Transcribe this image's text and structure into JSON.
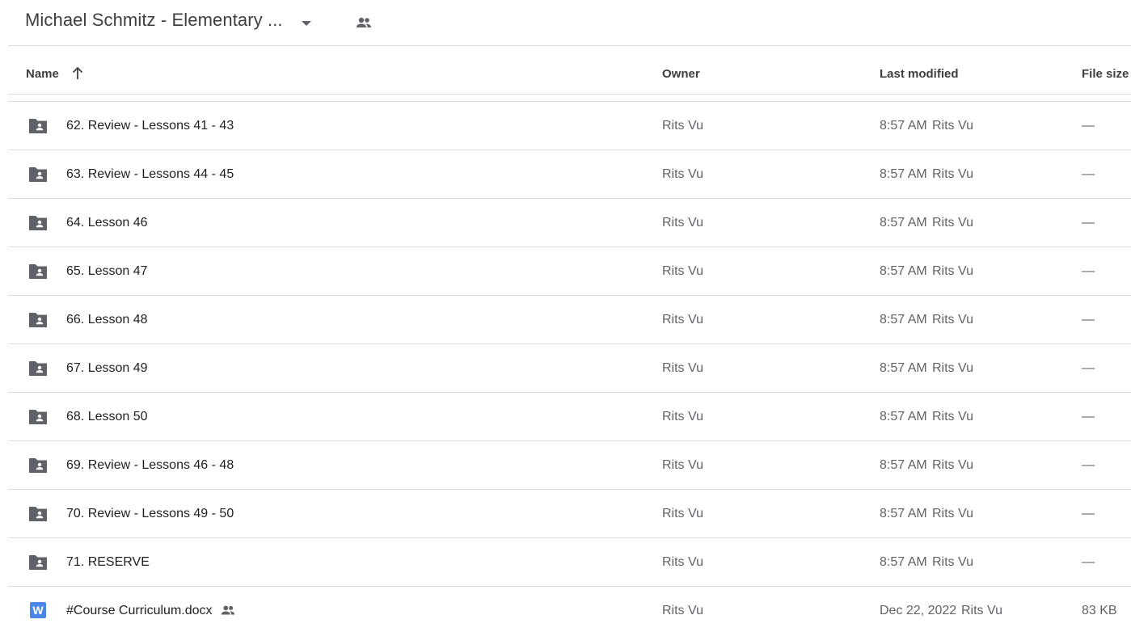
{
  "header": {
    "folder_title": "Michael Schmitz - Elementary ...",
    "dropdown_icon": "arrow-drop-down-icon",
    "shared_icon": "people-icon"
  },
  "columns": {
    "name": "Name",
    "owner": "Owner",
    "last_modified": "Last modified",
    "file_size": "File size",
    "sort_icon": "arrow-up-icon"
  },
  "rows": [
    {
      "name": "62. Review - Lessons 41 - 43",
      "owner": "Rits Vu",
      "modified_date": "8:57 AM",
      "modified_by": "Rits Vu",
      "size": "—",
      "type": "shared-folder"
    },
    {
      "name": "63. Review - Lessons 44 - 45",
      "owner": "Rits Vu",
      "modified_date": "8:57 AM",
      "modified_by": "Rits Vu",
      "size": "—",
      "type": "shared-folder"
    },
    {
      "name": "64. Lesson 46",
      "owner": "Rits Vu",
      "modified_date": "8:57 AM",
      "modified_by": "Rits Vu",
      "size": "—",
      "type": "shared-folder"
    },
    {
      "name": "65. Lesson 47",
      "owner": "Rits Vu",
      "modified_date": "8:57 AM",
      "modified_by": "Rits Vu",
      "size": "—",
      "type": "shared-folder"
    },
    {
      "name": "66. Lesson 48",
      "owner": "Rits Vu",
      "modified_date": "8:57 AM",
      "modified_by": "Rits Vu",
      "size": "—",
      "type": "shared-folder"
    },
    {
      "name": "67. Lesson 49",
      "owner": "Rits Vu",
      "modified_date": "8:57 AM",
      "modified_by": "Rits Vu",
      "size": "—",
      "type": "shared-folder"
    },
    {
      "name": "68. Lesson 50",
      "owner": "Rits Vu",
      "modified_date": "8:57 AM",
      "modified_by": "Rits Vu",
      "size": "—",
      "type": "shared-folder"
    },
    {
      "name": "69. Review - Lessons 46 - 48",
      "owner": "Rits Vu",
      "modified_date": "8:57 AM",
      "modified_by": "Rits Vu",
      "size": "—",
      "type": "shared-folder"
    },
    {
      "name": "70. Review - Lessons 49 - 50",
      "owner": "Rits Vu",
      "modified_date": "8:57 AM",
      "modified_by": "Rits Vu",
      "size": "—",
      "type": "shared-folder"
    },
    {
      "name": "71. RESERVE",
      "owner": "Rits Vu",
      "modified_date": "8:57 AM",
      "modified_by": "Rits Vu",
      "size": "—",
      "type": "shared-folder"
    },
    {
      "name": "#Course Curriculum.docx",
      "owner": "Rits Vu",
      "modified_date": "Dec 22, 2022",
      "modified_by": "Rits Vu",
      "size": "83 KB",
      "type": "word-doc",
      "shared": true,
      "icon_letter": "W"
    }
  ]
}
